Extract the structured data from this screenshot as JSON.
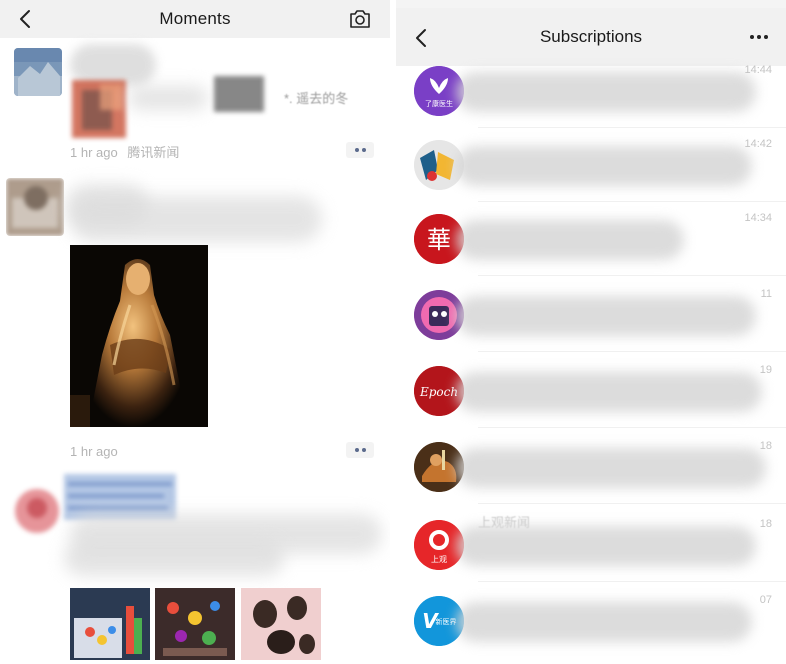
{
  "moments": {
    "title": "Moments",
    "posts": [
      {
        "excerpt_fragment": "*. 遥去的冬",
        "time": "1 hr ago",
        "source": "腾讯新闻"
      },
      {
        "time": "1 hr ago"
      }
    ]
  },
  "subscriptions": {
    "title": "Subscriptions",
    "items": [
      {
        "time": "14:44",
        "badge_text": "了康医生",
        "avatar_color": "#7a3fc6"
      },
      {
        "time": "14:42",
        "avatar_color": "#e8e8e8"
      },
      {
        "time": "14:34",
        "badge_text": "華",
        "avatar_color": "#c8161d"
      },
      {
        "time": "11",
        "avatar_color": "#9b4fb0"
      },
      {
        "time": "19",
        "badge_text": "Epoch",
        "avatar_color": "#b3151b"
      },
      {
        "time": "18",
        "avatar_color": "#5b3b20"
      },
      {
        "time": "18",
        "name": "上观新闻",
        "badge_text": "上观",
        "avatar_color": "#e62629"
      },
      {
        "time": "07",
        "badge_text": "V",
        "badge_sub": "新医界",
        "avatar_color": "#1296db"
      }
    ]
  },
  "colors": {
    "header_bg": "#f1f1f1",
    "meta_text": "#b4b4b4",
    "more_dots": "#5b6a8c"
  }
}
